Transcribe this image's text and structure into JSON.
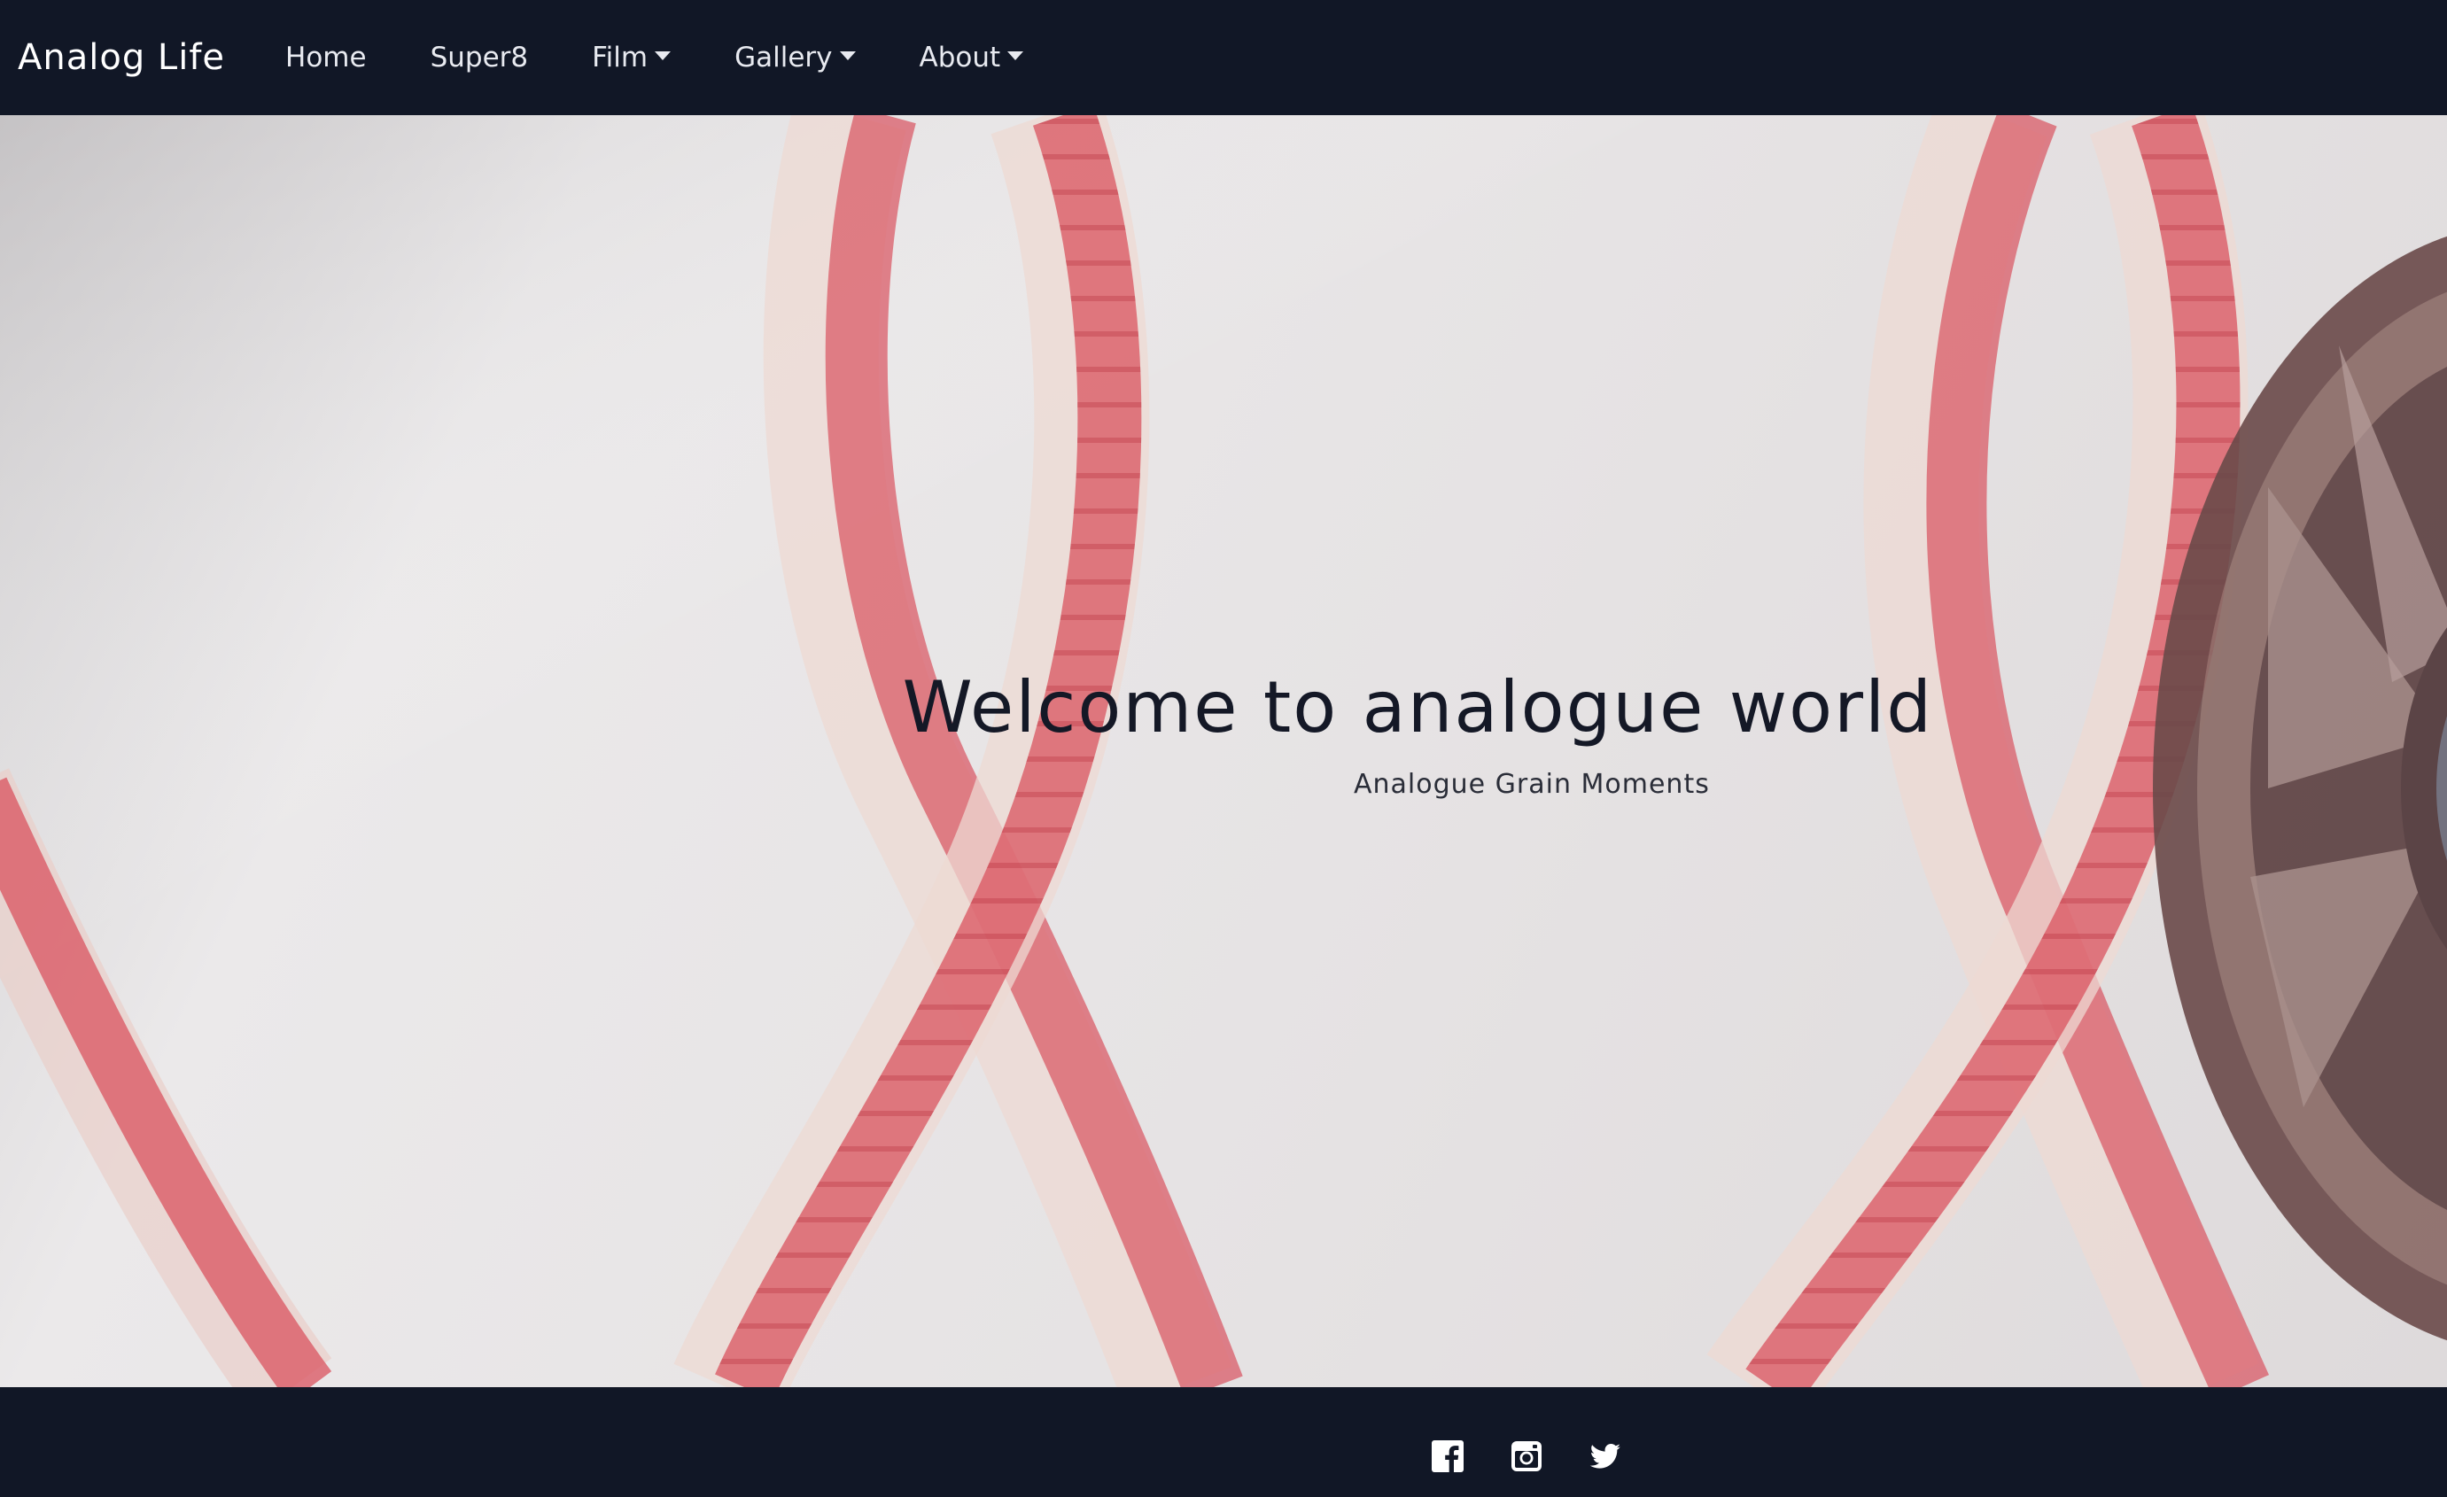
{
  "navbar": {
    "brand": "Analog Life",
    "items": [
      {
        "label": "Home",
        "dropdown": false
      },
      {
        "label": "Super8",
        "dropdown": false
      },
      {
        "label": "Film",
        "dropdown": true
      },
      {
        "label": "Gallery",
        "dropdown": true
      },
      {
        "label": "About",
        "dropdown": true
      }
    ]
  },
  "hero": {
    "title": "Welcome to analogue world",
    "subtitle": "Analogue Grain Moments"
  },
  "footer": {
    "social": [
      {
        "icon": "facebook-icon"
      },
      {
        "icon": "instagram-icon"
      },
      {
        "icon": "twitter-icon"
      }
    ]
  },
  "colors": {
    "navbar_bg": "#111726",
    "film_red": "#d7505e",
    "text_dark": "#141826"
  }
}
